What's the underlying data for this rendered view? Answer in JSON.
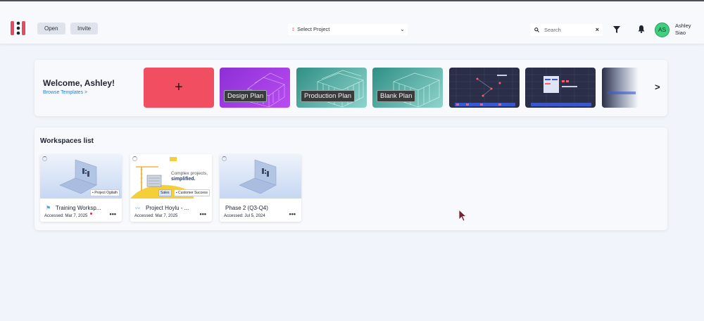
{
  "header": {
    "open_label": "Open",
    "invite_label": "Invite",
    "project_select": "Select Project",
    "search_placeholder": "Search",
    "user_initials": "AS",
    "user_name_first": "Ashley",
    "user_name_last": "Siao"
  },
  "welcome": {
    "title": "Welcome, Ashley!",
    "browse_link": "Browse Templates >",
    "templates": [
      {
        "label": "Design Plan"
      },
      {
        "label": "Production Plan"
      },
      {
        "label": "Blank Plan"
      }
    ]
  },
  "workspaces": {
    "title": "Workspaces list",
    "items": [
      {
        "name": "Training Worksp...",
        "accessed": "Accessed: Mar 7, 2025",
        "badge": "Project Ogilath"
      },
      {
        "name": "Project Hoylu - ...",
        "accessed": "Accessed: Mar 7, 2025",
        "badge": "Customer Success",
        "badge2": "Sales",
        "promo_line1": "Complex projects,",
        "promo_line2": "simplified."
      },
      {
        "name": "Phase 2 (Q3-Q4)",
        "accessed": "Accessed: Jul 5, 2024"
      }
    ]
  },
  "colors": {
    "accent_red": "#f14e62",
    "link_blue": "#2c7be0",
    "avatar_green": "#3fcf7f"
  }
}
